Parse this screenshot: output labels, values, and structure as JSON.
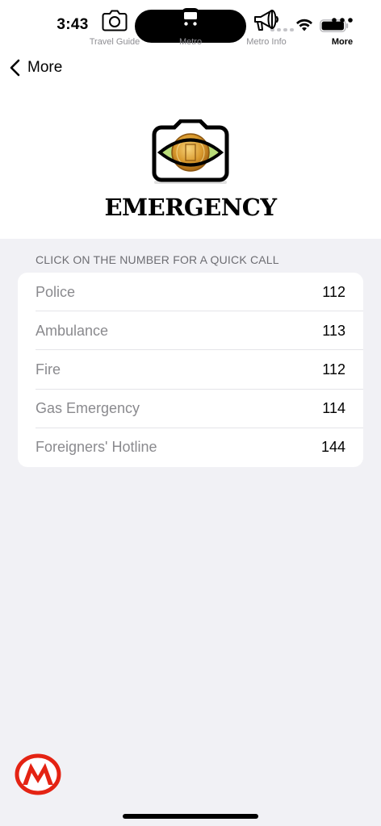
{
  "status_bar": {
    "time": "3:43"
  },
  "nav": {
    "back_label": "More"
  },
  "hero": {
    "title": "EMERGENCY"
  },
  "list": {
    "header": "CLICK ON THE NUMBER FOR A QUICK CALL",
    "items": [
      {
        "label": "Police",
        "number": "112"
      },
      {
        "label": "Ambulance",
        "number": "113"
      },
      {
        "label": "Fire",
        "number": "112"
      },
      {
        "label": "Gas Emergency",
        "number": "114"
      },
      {
        "label": "Foreigners' Hotline",
        "number": "144"
      }
    ]
  },
  "tabbar": {
    "tabs": [
      {
        "label": "Travel Guide",
        "icon": "camera-icon"
      },
      {
        "label": "Metro",
        "icon": "train-icon"
      },
      {
        "label": "Metro Info",
        "icon": "megaphone-icon"
      },
      {
        "label": "More",
        "icon": "more-icon",
        "active": true
      }
    ]
  },
  "colors": {
    "accent_red": "#e42313",
    "background": "#f1f1f5",
    "inactive_tab": "#8e8e93"
  }
}
